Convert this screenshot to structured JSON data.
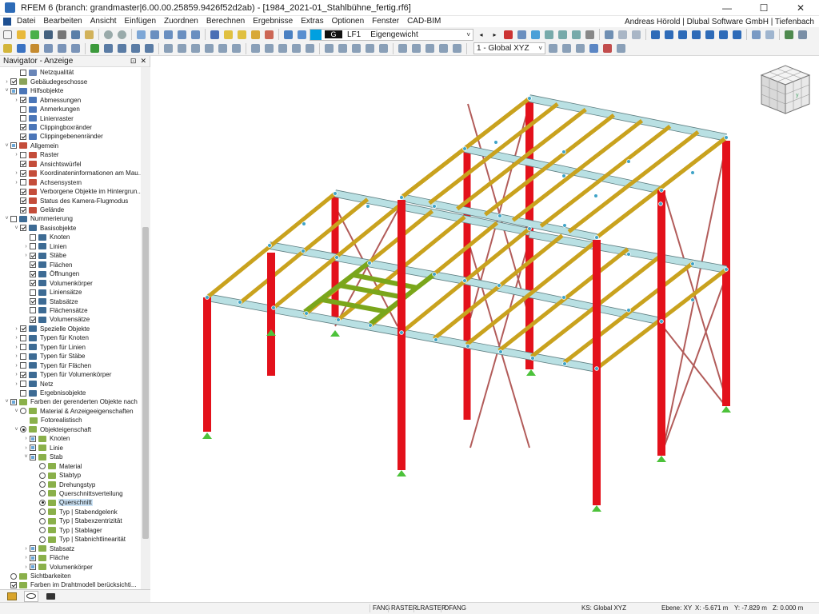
{
  "window": {
    "title": "RFEM 6 (branch: grandmaster|6.00.00.25859.9426f52d2ab) - [1984_2021-01_Stahlbühne_fertig.rf6]",
    "minimize": "—",
    "maximize": "☐",
    "close": "✕"
  },
  "menu": {
    "items": [
      "Datei",
      "Bearbeiten",
      "Ansicht",
      "Einfügen",
      "Zuordnen",
      "Berechnen",
      "Ergebnisse",
      "Extras",
      "Optionen",
      "Fenster",
      "CAD-BIM"
    ],
    "user": "Andreas Hörold | Dlubal Software GmbH | Tiefenbach"
  },
  "toolbar": {
    "loadcase_tag": "G",
    "loadcase_id": "LF1",
    "loadcase_name": "Eigengewicht",
    "coord_system": "1 - Global XYZ"
  },
  "navigator": {
    "title": "Navigator - Anzeige",
    "pin": "⊡",
    "close": "✕",
    "items": [
      {
        "label": "Netzqualität",
        "level": 1,
        "exp": "",
        "check": "off",
        "icon": "mesh"
      },
      {
        "label": "Gebäudegeschosse",
        "level": 0,
        "exp": "›",
        "check": "on",
        "icon": "storey"
      },
      {
        "label": "Hilfsobjekte",
        "level": 0,
        "exp": "˅",
        "check": "part",
        "icon": "help"
      },
      {
        "label": "Abmessungen",
        "level": 1,
        "exp": "›",
        "check": "on",
        "icon": "help"
      },
      {
        "label": "Anmerkungen",
        "level": 1,
        "exp": "",
        "check": "off",
        "icon": "help"
      },
      {
        "label": "Linienraster",
        "level": 1,
        "exp": "",
        "check": "off",
        "icon": "help"
      },
      {
        "label": "Clippingboxränder",
        "level": 1,
        "exp": "",
        "check": "on",
        "icon": "help"
      },
      {
        "label": "Clippingebenenränder",
        "level": 1,
        "exp": "",
        "check": "on",
        "icon": "help"
      },
      {
        "label": "Allgemein",
        "level": 0,
        "exp": "˅",
        "check": "part",
        "icon": "gen"
      },
      {
        "label": "Raster",
        "level": 1,
        "exp": "›",
        "check": "off",
        "icon": "gen"
      },
      {
        "label": "Ansichtswürfel",
        "level": 1,
        "exp": "",
        "check": "on",
        "icon": "gen"
      },
      {
        "label": "Koordinateninformationen am Mau...",
        "level": 1,
        "exp": "›",
        "check": "on",
        "icon": "gen"
      },
      {
        "label": "Achsensystem",
        "level": 1,
        "exp": "›",
        "check": "off",
        "icon": "gen"
      },
      {
        "label": "Verborgene Objekte im Hintergrun...",
        "level": 1,
        "exp": "",
        "check": "on",
        "icon": "gen"
      },
      {
        "label": "Status des Kamera-Flugmodus",
        "level": 1,
        "exp": "",
        "check": "on",
        "icon": "gen"
      },
      {
        "label": "Gelände",
        "level": 1,
        "exp": "",
        "check": "on",
        "icon": "gen"
      },
      {
        "label": "Nummerierung",
        "level": 0,
        "exp": "˅",
        "check": "off",
        "icon": "num"
      },
      {
        "label": "Basisobjekte",
        "level": 1,
        "exp": "˅",
        "check": "on",
        "icon": "num"
      },
      {
        "label": "Knoten",
        "level": 2,
        "exp": "",
        "check": "off",
        "icon": "num"
      },
      {
        "label": "Linien",
        "level": 2,
        "exp": "›",
        "check": "off",
        "icon": "num"
      },
      {
        "label": "Stäbe",
        "level": 2,
        "exp": "›",
        "check": "on",
        "icon": "num"
      },
      {
        "label": "Flächen",
        "level": 2,
        "exp": "",
        "check": "on",
        "icon": "num"
      },
      {
        "label": "Öffnungen",
        "level": 2,
        "exp": "",
        "check": "on",
        "icon": "num"
      },
      {
        "label": "Volumenkörper",
        "level": 2,
        "exp": "",
        "check": "on",
        "icon": "num"
      },
      {
        "label": "Liniensätze",
        "level": 2,
        "exp": "",
        "check": "off",
        "icon": "num"
      },
      {
        "label": "Stabsätze",
        "level": 2,
        "exp": "",
        "check": "on",
        "icon": "num"
      },
      {
        "label": "Flächensätze",
        "level": 2,
        "exp": "",
        "check": "off",
        "icon": "num"
      },
      {
        "label": "Volumensätze",
        "level": 2,
        "exp": "",
        "check": "on",
        "icon": "num"
      },
      {
        "label": "Spezielle Objekte",
        "level": 1,
        "exp": "›",
        "check": "on",
        "icon": "num"
      },
      {
        "label": "Typen für Knoten",
        "level": 1,
        "exp": "›",
        "check": "off",
        "icon": "num"
      },
      {
        "label": "Typen für Linien",
        "level": 1,
        "exp": "›",
        "check": "off",
        "icon": "num"
      },
      {
        "label": "Typen für Stäbe",
        "level": 1,
        "exp": "›",
        "check": "off",
        "icon": "num"
      },
      {
        "label": "Typen für Flächen",
        "level": 1,
        "exp": "›",
        "check": "off",
        "icon": "num"
      },
      {
        "label": "Typen für Volumenkörper",
        "level": 1,
        "exp": "›",
        "check": "on",
        "icon": "num"
      },
      {
        "label": "Netz",
        "level": 1,
        "exp": "›",
        "check": "off",
        "icon": "num"
      },
      {
        "label": "Ergebnisobjekte",
        "level": 1,
        "exp": "",
        "check": "off",
        "icon": "num"
      },
      {
        "label": "Farben der gerenderten Objekte nach",
        "level": 0,
        "exp": "˅",
        "check": "part",
        "icon": "color"
      },
      {
        "label": "Material & Anzeigeeigenschaften",
        "level": 1,
        "exp": "˅",
        "radio": "off",
        "icon": "color"
      },
      {
        "label": "Fotorealistisch",
        "level": 2,
        "exp": "",
        "radio": "none",
        "icon": "color"
      },
      {
        "label": "Objekteigenschaft",
        "level": 1,
        "exp": "˅",
        "radio": "on",
        "icon": "color"
      },
      {
        "label": "Knoten",
        "level": 2,
        "exp": "›",
        "check": "part",
        "icon": "color"
      },
      {
        "label": "Linie",
        "level": 2,
        "exp": "›",
        "check": "part",
        "icon": "color"
      },
      {
        "label": "Stab",
        "level": 2,
        "exp": "˅",
        "check": "part",
        "icon": "color"
      },
      {
        "label": "Material",
        "level": 3,
        "exp": "",
        "radio": "off",
        "icon": "color"
      },
      {
        "label": "Stabtyp",
        "level": 3,
        "exp": "",
        "radio": "off",
        "icon": "color"
      },
      {
        "label": "Drehungstyp",
        "level": 3,
        "exp": "",
        "radio": "off",
        "icon": "color"
      },
      {
        "label": "Querschnittsverteilung",
        "level": 3,
        "exp": "",
        "radio": "off",
        "icon": "color"
      },
      {
        "label": "Querschnitt",
        "level": 3,
        "exp": "",
        "radio": "on",
        "icon": "color",
        "selected": true
      },
      {
        "label": "Typ | Stabendgelenk",
        "level": 3,
        "exp": "",
        "radio": "off",
        "icon": "color"
      },
      {
        "label": "Typ | Stabexzentrizität",
        "level": 3,
        "exp": "",
        "radio": "off",
        "icon": "color"
      },
      {
        "label": "Typ | Stablager",
        "level": 3,
        "exp": "",
        "radio": "off",
        "icon": "color"
      },
      {
        "label": "Typ | Stabnichtlinearität",
        "level": 3,
        "exp": "",
        "radio": "off",
        "icon": "color"
      },
      {
        "label": "Stabsatz",
        "level": 2,
        "exp": "›",
        "check": "part",
        "icon": "color"
      },
      {
        "label": "Fläche",
        "level": 2,
        "exp": "›",
        "check": "part",
        "icon": "color"
      },
      {
        "label": "Volumenkörper",
        "level": 2,
        "exp": "›",
        "check": "part",
        "icon": "color"
      },
      {
        "label": "Sichtbarkeiten",
        "level": 0,
        "exp": "",
        "radio": "off",
        "icon": "color"
      },
      {
        "label": "Farben im Drahtmodell berücksichti...",
        "level": 0,
        "exp": "",
        "check": "on",
        "icon": "color"
      }
    ]
  },
  "icon_colors": {
    "mesh": "#6a86b8",
    "storey": "#8aa35a",
    "help": "#4b76b8",
    "gen": "#c44d3a",
    "num": "#3d6b94",
    "color": "#8ab04a"
  },
  "colors": {
    "column": "#e3111b",
    "beam_blue": "#b9e0e3",
    "beam_gold": "#c9a21e",
    "beam_green": "#7aa61b",
    "brace": "#b25c5a",
    "node": "#3fa3c7",
    "support": "#4cc23a"
  },
  "statusbar": {
    "toggles": [
      "FANG",
      "RASTER",
      "LRASTER",
      "OFANG"
    ],
    "ks": "KS: Global XYZ",
    "ebene": "Ebene: XY",
    "x": "X: -5.671 m",
    "y": "Y: -7.829 m",
    "z": "Z: 0.000 m"
  }
}
